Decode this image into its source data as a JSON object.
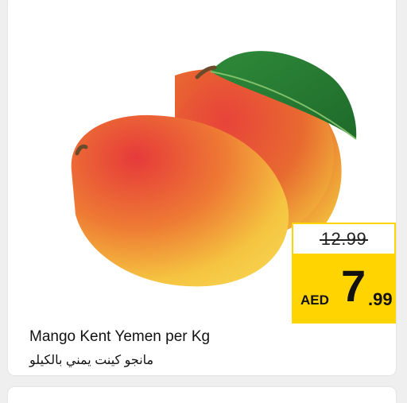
{
  "product": {
    "name_en": "Mango Kent Yemen per Kg",
    "name_ar": "مانجو كينت يمني بالكيلو",
    "image_icon": "mango-image"
  },
  "price": {
    "old": "12.99",
    "currency": "AED",
    "new_integer": "7",
    "new_decimal": ".99"
  },
  "colors": {
    "tag_yellow": "#ffd400",
    "background": "#efefef",
    "card": "#ffffff"
  }
}
